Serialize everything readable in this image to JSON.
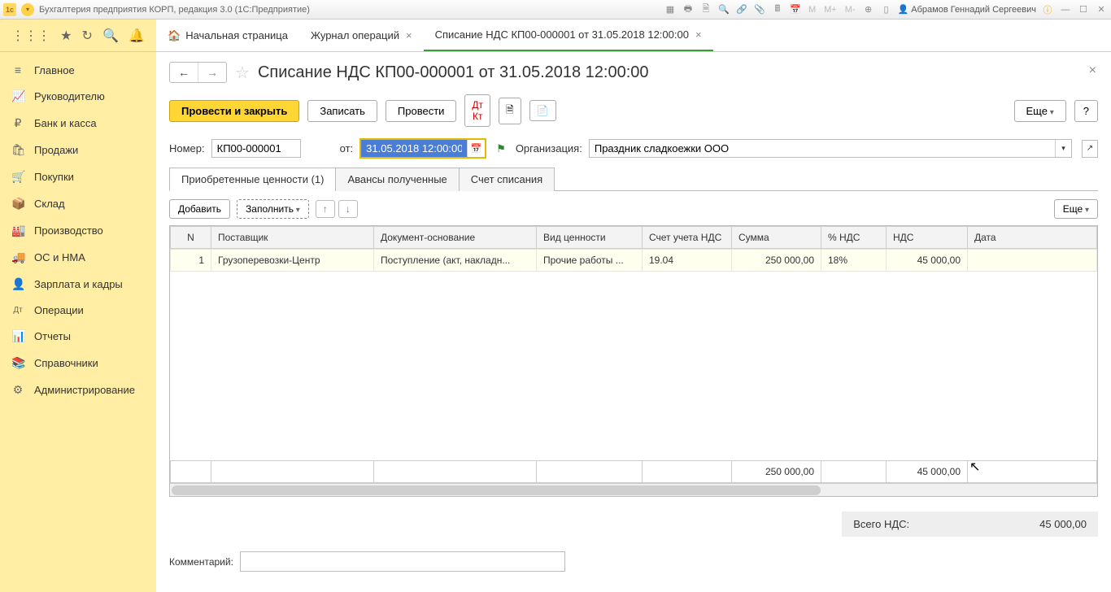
{
  "titlebar": {
    "app_title": "Бухгалтерия предприятия КОРП, редакция 3.0  (1С:Предприятие)",
    "user_name": "Абрамов Геннадий Сергеевич",
    "m_buttons": [
      "M",
      "M+",
      "M-"
    ]
  },
  "tabs": {
    "home": "Начальная страница",
    "journal": "Журнал операций",
    "doc": "Списание НДС КП00-000001 от 31.05.2018 12:00:00"
  },
  "sidebar": {
    "items": [
      {
        "icon": "≡",
        "label": "Главное"
      },
      {
        "icon": "📈",
        "label": "Руководителю"
      },
      {
        "icon": "₽",
        "label": "Банк и касса"
      },
      {
        "icon": "🛍",
        "label": "Продажи"
      },
      {
        "icon": "🛒",
        "label": "Покупки"
      },
      {
        "icon": "📦",
        "label": "Склад"
      },
      {
        "icon": "🏭",
        "label": "Производство"
      },
      {
        "icon": "🚚",
        "label": "ОС и НМА"
      },
      {
        "icon": "👤",
        "label": "Зарплата и кадры"
      },
      {
        "icon": "Дт",
        "label": "Операции"
      },
      {
        "icon": "📊",
        "label": "Отчеты"
      },
      {
        "icon": "📚",
        "label": "Справочники"
      },
      {
        "icon": "⚙",
        "label": "Администрирование"
      }
    ]
  },
  "doc": {
    "title": "Списание НДС КП00-000001 от 31.05.2018 12:00:00",
    "buttons": {
      "post_close": "Провести и закрыть",
      "save": "Записать",
      "post": "Провести",
      "more": "Еще",
      "help": "?"
    },
    "labels": {
      "number": "Номер:",
      "date_from": "от:",
      "org": "Организация:"
    },
    "number": "КП00-000001",
    "date": "31.05.2018 12:00:00",
    "org": "Праздник сладкоежки ООО",
    "doc_tabs": {
      "t1": "Приобретенные ценности (1)",
      "t2": "Авансы полученные",
      "t3": "Счет списания"
    },
    "table_tools": {
      "add": "Добавить",
      "fill": "Заполнить",
      "more": "Еще"
    },
    "columns": {
      "n": "N",
      "supplier": "Поставщик",
      "basis": "Документ-основание",
      "kind": "Вид ценности",
      "account": "Счет учета НДС",
      "sum": "Сумма",
      "vat_pct": "% НДС",
      "vat": "НДС",
      "date": "Дата"
    },
    "rows": [
      {
        "n": "1",
        "supplier": "Грузоперевозки-Центр",
        "basis": "Поступление (акт, накладн...",
        "kind": "Прочие работы ...",
        "account": "19.04",
        "sum": "250 000,00",
        "vat_pct": "18%",
        "vat": "45 000,00"
      }
    ],
    "totals": {
      "sum": "250 000,00",
      "vat": "45 000,00"
    },
    "total_vat_label": "Всего НДС:",
    "total_vat": "45 000,00",
    "comment_label": "Комментарий:"
  }
}
